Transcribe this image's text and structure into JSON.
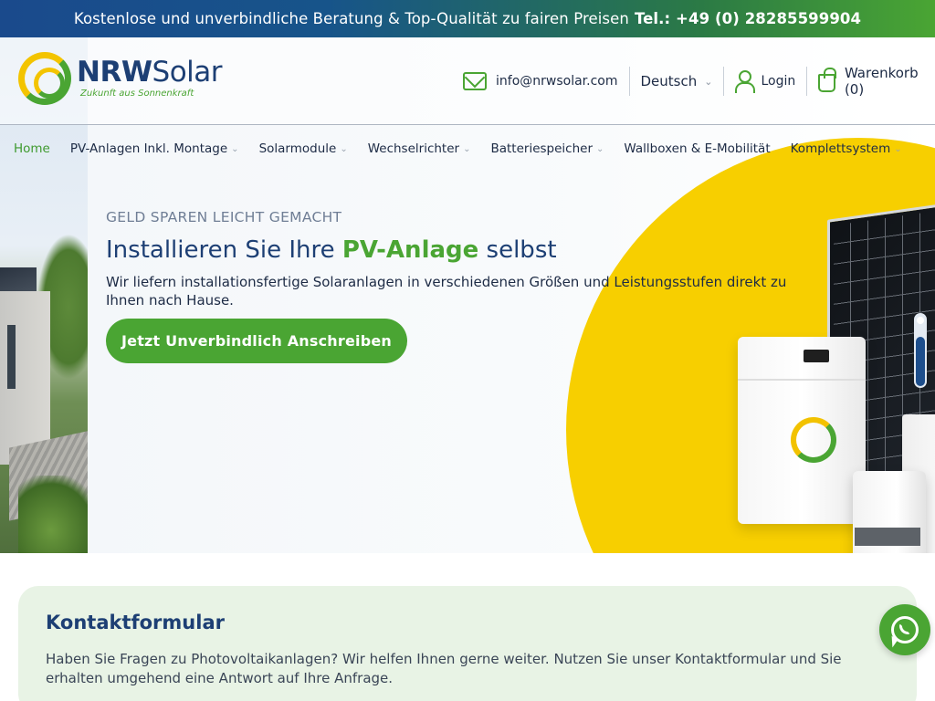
{
  "topbar": {
    "message": "Kostenlose und unverbindliche Beratung & Top-Qualität zu fairen Preisen",
    "phone": "Tel.: +49 (0) 28285599904"
  },
  "header": {
    "logo_brand_bold": "NRW",
    "logo_brand_light": "Solar",
    "logo_tagline": "Zukunft aus Sonnenkraft",
    "email": "info@nrwsolar.com",
    "language": "Deutsch",
    "login": "Login",
    "cart": "Warenkorb (0)"
  },
  "nav": {
    "items": [
      {
        "label": "Home",
        "active": true
      },
      {
        "label": "PV-Anlagen Inkl. Montage"
      },
      {
        "label": "Solarmodule"
      },
      {
        "label": "Wechselrichter"
      },
      {
        "label": "Batteriespeicher"
      },
      {
        "label": "Wallboxen & E-Mobilität"
      },
      {
        "label": "Komplettsystem"
      }
    ]
  },
  "hero": {
    "eyebrow": "GELD SPAREN LEICHT GEMACHT",
    "headline_before": "Installieren Sie Ihre ",
    "headline_accent": "PV-Anlage",
    "headline_after": " selbst",
    "subtext": "Wir liefern installationsfertige Solaranlagen in verschiedenen Größen und Leistungsstufen direkt zu Ihnen nach Hause.",
    "cta": "Jetzt Unverbindlich Anschreiben"
  },
  "contact": {
    "title": "Kontaktformular",
    "text": "Haben Sie Fragen zu Photovoltaikanlagen? Wir helfen Ihnen gerne weiter. Nutzen Sie unser Kontaktformular und Sie erhalten umgehend eine Antwort auf Ihre Anfrage."
  },
  "icons": {
    "mail": "mail-icon",
    "user": "user-icon",
    "cart": "shopping-bag-icon",
    "chevron": "chevron-down-icon",
    "whatsapp": "whatsapp-icon"
  },
  "colors": {
    "brand_green": "#4aa533",
    "brand_blue": "#1d3f74",
    "sun_yellow": "#f7cf00",
    "contact_bg": "#e8f3e5"
  }
}
